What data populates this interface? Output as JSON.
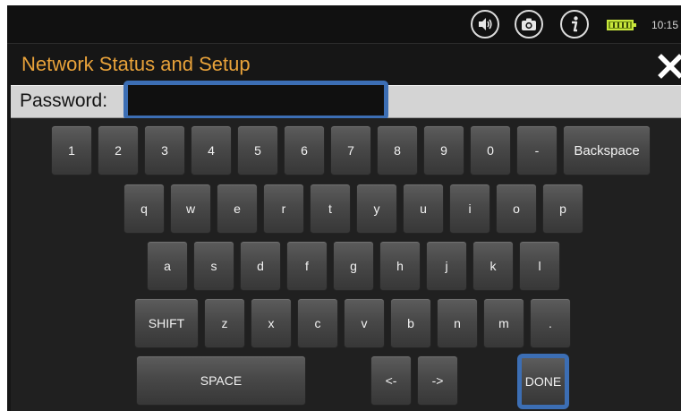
{
  "status_bar": {
    "clock": "10:15",
    "icons": [
      "volume-icon",
      "camera-icon",
      "info-icon",
      "battery-icon"
    ]
  },
  "title_bar": {
    "title": "Network Status and Setup",
    "close_icon": "close-icon"
  },
  "password_row": {
    "label": "Password:",
    "value": ""
  },
  "keyboard": {
    "number_row": [
      "1",
      "2",
      "3",
      "4",
      "5",
      "6",
      "7",
      "8",
      "9",
      "0",
      "-",
      "Backspace"
    ],
    "row_q": [
      "q",
      "w",
      "e",
      "r",
      "t",
      "y",
      "u",
      "i",
      "o",
      "p"
    ],
    "row_a": [
      "a",
      "s",
      "d",
      "f",
      "g",
      "h",
      "j",
      "k",
      "l"
    ],
    "row_z": [
      "SHIFT",
      "z",
      "x",
      "c",
      "v",
      "b",
      "n",
      "m",
      "."
    ],
    "bottom_row": [
      "SPACE",
      "<-",
      "->",
      "DONE"
    ]
  },
  "colors": {
    "title": "#e8a23a",
    "focus_highlight": "#3c6eb4",
    "battery": "#c8e63c"
  }
}
